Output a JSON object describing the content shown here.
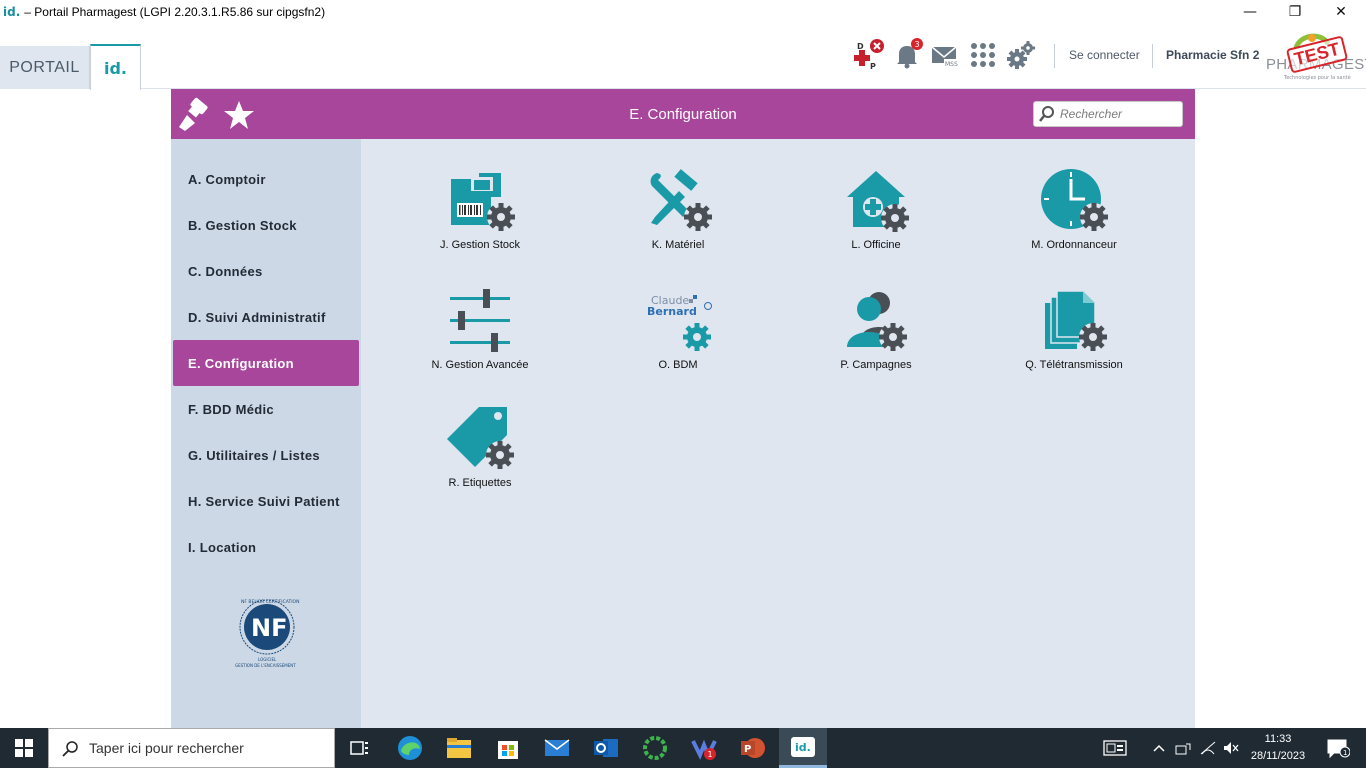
{
  "window": {
    "logo": "id.",
    "title": "– Portail Pharmagest (LGPI 2.20.3.1.R5.86 sur cipgsfn2)",
    "minimize": "—",
    "restore": "❐",
    "close": "✕"
  },
  "header": {
    "tab_portail": "PORTAIL",
    "tab_id": "id.",
    "notification_count": "3",
    "mss_label": "MSS",
    "dp_label_d": "D",
    "dp_label_p": "P",
    "se_connecter": "Se connecter",
    "pharmacie": "Pharmacie Sfn 2",
    "brand_name": "PHARMAGEST",
    "brand_stamp": "TEST",
    "brand_tagline": "Technologies pour la santé"
  },
  "panel": {
    "title": "E. Configuration",
    "search_placeholder": "Rechercher"
  },
  "sidebar": {
    "items": [
      {
        "label": "A. Comptoir"
      },
      {
        "label": "B. Gestion Stock"
      },
      {
        "label": "C. Données"
      },
      {
        "label": "D. Suivi Administratif"
      },
      {
        "label": "E. Configuration"
      },
      {
        "label": "F. BDD Médic"
      },
      {
        "label": "G. Utilitaires / Listes"
      },
      {
        "label": "H. Service Suivi Patient"
      },
      {
        "label": "I. Location"
      }
    ],
    "active_index": 4,
    "nf_logo": "NF",
    "nf_top": "NF BEHOR CERTIFICATION",
    "nf_line1": "LOGICIEL",
    "nf_line2": "GESTION DE L'ENCAISSEMENT"
  },
  "tiles": [
    {
      "label": "J. Gestion Stock",
      "icon": "stock-gear-icon"
    },
    {
      "label": "K. Matériel",
      "icon": "tools-gear-icon"
    },
    {
      "label": "L. Officine",
      "icon": "pharmacy-house-gear-icon"
    },
    {
      "label": "M. Ordonnanceur",
      "icon": "clock-gear-icon"
    },
    {
      "label": "N. Gestion Avancée",
      "icon": "sliders-gear-icon"
    },
    {
      "label": "O. BDM",
      "icon": "claude-bernard-gear-icon",
      "brand_line1": "Claude",
      "brand_line2": "Bernard"
    },
    {
      "label": "P. Campagnes",
      "icon": "users-gear-icon"
    },
    {
      "label": "Q. Télétransmission",
      "icon": "documents-gear-icon"
    },
    {
      "label": "R. Etiquettes",
      "icon": "tag-gear-icon"
    }
  ],
  "taskbar": {
    "search_placeholder": "Taper ici pour rechercher",
    "time": "11:33",
    "date": "28/11/2023",
    "outlook_badge": "1",
    "notification_badge": "1"
  },
  "colors": {
    "accent_purple": "#a7469b",
    "icon_teal": "#1a9aa7",
    "gear_gray": "#4a4f55",
    "sidebar_bg": "#cdd8e6",
    "content_bg": "#dfe6f0"
  }
}
